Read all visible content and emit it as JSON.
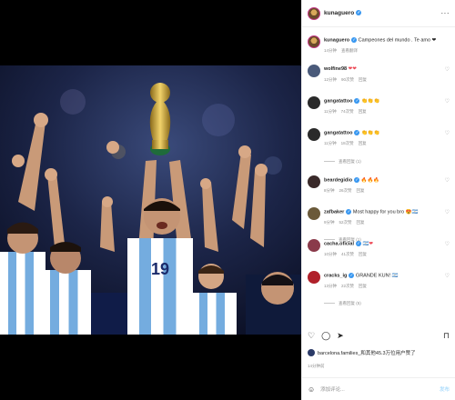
{
  "post_author": {
    "username": "kunaguero",
    "verified_mark": "✓"
  },
  "header_more": "···",
  "caption": {
    "username": "kunaguero",
    "text": "Campeones del mundo . Te amo ❤",
    "time": "14分钟",
    "translate": "查看翻译"
  },
  "comments": [
    {
      "username": "wolfine98",
      "text": "❤❤",
      "time": "12分钟",
      "likes": "90次赞",
      "reply": "回复",
      "avatar_color": "#4a5a7a"
    },
    {
      "username": "gangatattoo",
      "text": "👏👏👏",
      "time": "11分钟",
      "likes": "74次赞",
      "reply": "回复",
      "avatar_color": "#2a2a2a",
      "verified": "✓"
    },
    {
      "username": "gangatattoo",
      "text": "👏👏👏",
      "time": "11分钟",
      "likes": "18次赞",
      "reply": "回复",
      "avatar_color": "#2a2a2a",
      "verified": "✓",
      "view_replies": "查看回复 (1)"
    },
    {
      "username": "beardegidio",
      "text": "🔥🔥🔥",
      "time": "8分钟",
      "likes": "26次赞",
      "reply": "回复",
      "avatar_color": "#3a2a2a",
      "verified": "✓"
    },
    {
      "username": "zafbaker",
      "text": "Most happy for you bro 😍🇦🇷",
      "time": "9分钟",
      "likes": "52次赞",
      "reply": "回复",
      "avatar_color": "#6b5a3a",
      "verified": "✓",
      "view_replies": "查看回复 (1)"
    },
    {
      "username": "cacha.oficial",
      "text": "🇦🇷❤",
      "time": "10分钟",
      "likes": "41次赞",
      "reply": "回复",
      "avatar_color": "#8a3a4a",
      "verified": "✓"
    },
    {
      "username": "cracks_ig",
      "text": "GRANDE KUN! 🇦🇷",
      "time": "13分钟",
      "likes": "22次赞",
      "reply": "回复",
      "avatar_color": "#b0202a",
      "verified": "✓",
      "view_replies": "查看回复 (5)"
    }
  ],
  "actions": {
    "like": "♡",
    "comment": "◯",
    "share": "➤",
    "save": "⊓"
  },
  "liked_by": "barcelona.families_和其他45.3万位用户赞了",
  "post_time": "14分钟前",
  "add_comment": {
    "emoji": "☺",
    "placeholder": "添加评论...",
    "post": "发布"
  },
  "colors": {
    "verified": "#3897f0",
    "link": "#b2dffc",
    "heart_red": "#ed4956",
    "argentina_blue": "#74acdf"
  },
  "icons": [
    "more-icon",
    "heart-icon",
    "comment-icon",
    "share-icon",
    "bookmark-icon",
    "emoji-icon",
    "verified-icon"
  ]
}
